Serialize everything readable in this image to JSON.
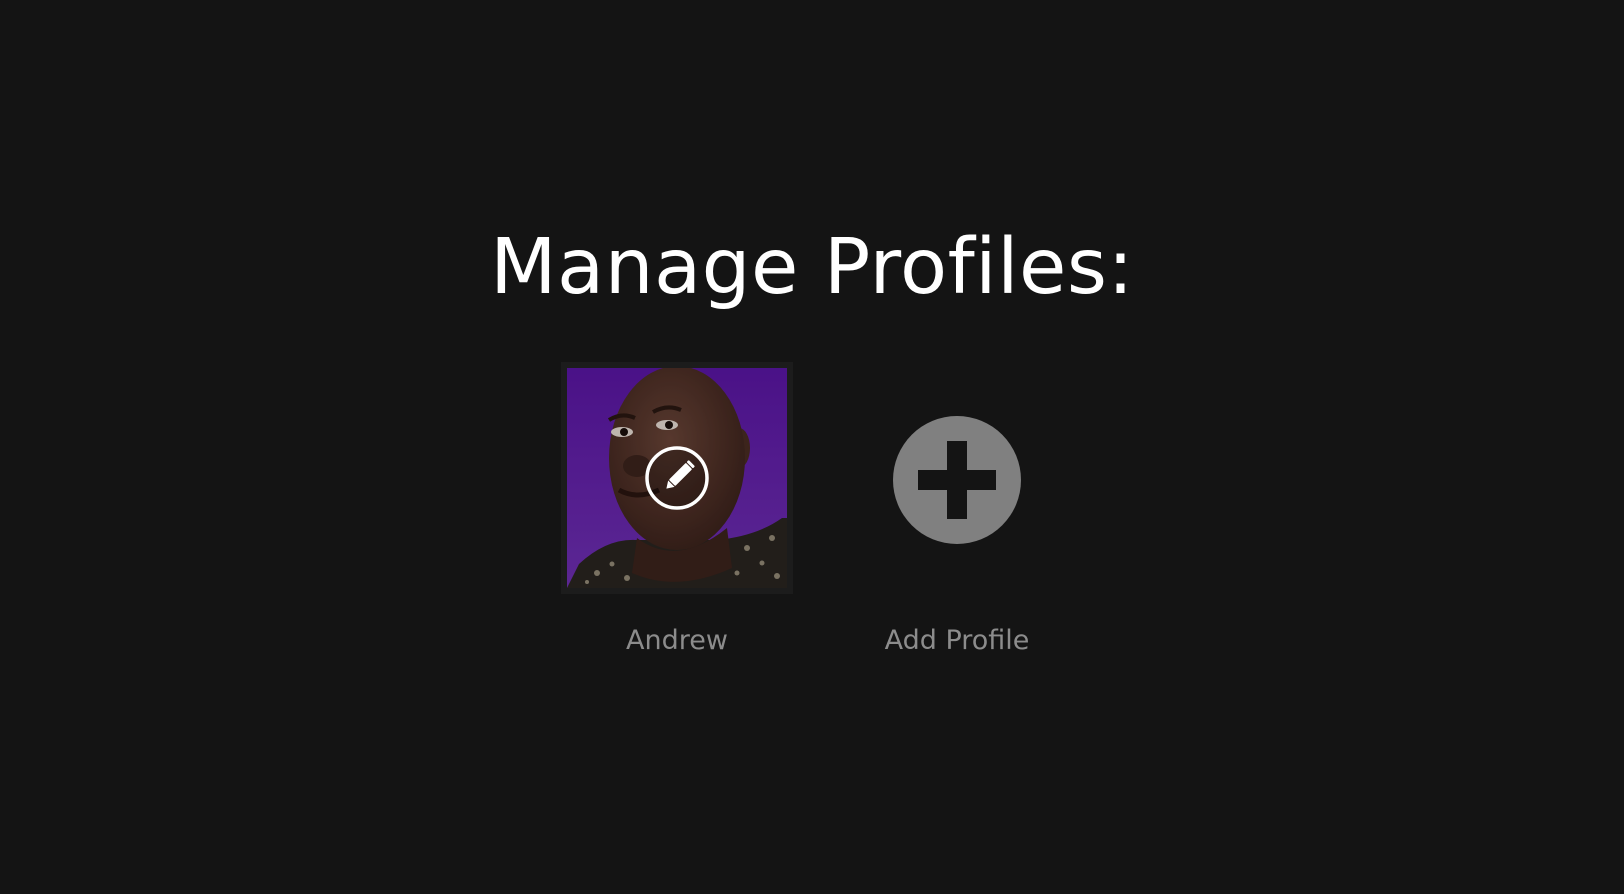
{
  "page": {
    "title": "Manage Profiles:"
  },
  "profiles": [
    {
      "name": "Andrew",
      "avatar_icon": "profile-avatar-portrait",
      "overlay_icon": "pencil-edit-icon",
      "avatar_background": "#5a1aa8"
    }
  ],
  "add_profile": {
    "label": "Add Profile",
    "icon": "plus-circle-icon",
    "icon_color": "#808080"
  },
  "colors": {
    "background": "#141414",
    "title_text": "#ffffff",
    "label_text": "#8c8c8c"
  }
}
